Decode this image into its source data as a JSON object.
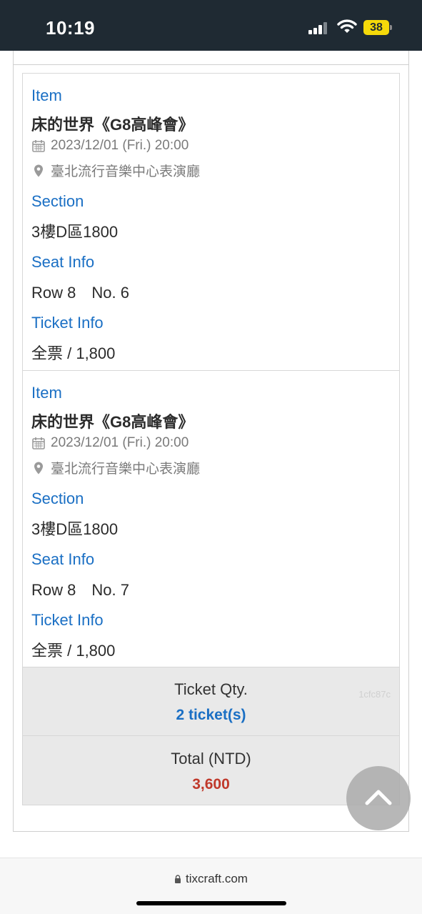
{
  "status_bar": {
    "time": "10:19",
    "battery": "38"
  },
  "tickets": [
    {
      "item_label": "Item",
      "event_name": "床的世界《G8高峰會》",
      "datetime": "2023/12/01 (Fri.) 20:00",
      "venue": "臺北流行音樂中心表演廳",
      "section_label": "Section",
      "section": "3樓D區1800",
      "seat_label": "Seat Info",
      "seat": "Row 8　No. 6",
      "ticket_label": "Ticket Info",
      "ticket": "全票 / 1,800"
    },
    {
      "item_label": "Item",
      "event_name": "床的世界《G8高峰會》",
      "datetime": "2023/12/01 (Fri.) 20:00",
      "venue": "臺北流行音樂中心表演廳",
      "section_label": "Section",
      "section": "3樓D區1800",
      "seat_label": "Seat Info",
      "seat": "Row 8　No. 7",
      "ticket_label": "Ticket Info",
      "ticket": "全票 / 1,800"
    }
  ],
  "summary": {
    "qty_label": "Ticket Qty.",
    "qty_value": "2 ticket(s)",
    "code": "1cfc87c",
    "total_label": "Total (NTD)",
    "total_value": "3,600"
  },
  "browser": {
    "url": "tixcraft.com"
  },
  "colors": {
    "accent": "#1a6fc4",
    "total": "#c0392b",
    "status_bar": "#1f2a33",
    "battery": "#f5d90a"
  },
  "icons": {
    "calendar": "calendar-icon",
    "location": "location-pin-icon",
    "scroll_top": "chevron-up-icon",
    "lock": "lock-icon"
  }
}
